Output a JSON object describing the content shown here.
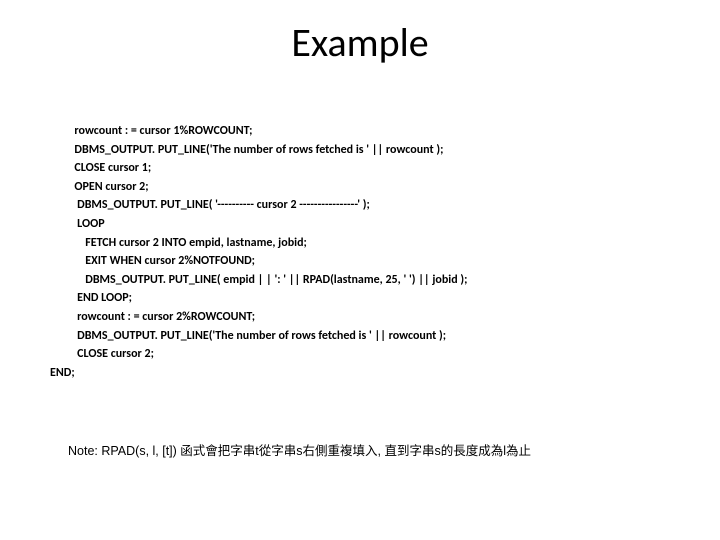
{
  "title": "Example",
  "code": "         rowcount : = cursor 1%ROWCOUNT;\n         DBMS_OUTPUT. PUT_LINE('The number of rows fetched is ' || rowcount );\n         CLOSE cursor 1;\n         OPEN cursor 2;\n          DBMS_OUTPUT. PUT_LINE( '---------- cursor 2 ----------------' );\n          LOOP\n             FETCH cursor 2 INTO empid, lastname, jobid;\n             EXIT WHEN cursor 2%NOTFOUND;\n             DBMS_OUTPUT. PUT_LINE( empid | | ': ' || RPAD(lastname, 25, ' ') || jobid );\n          END LOOP;\n          rowcount : = cursor 2%ROWCOUNT;\n          DBMS_OUTPUT. PUT_LINE('The number of rows fetched is ' || rowcount );\n          CLOSE cursor 2;\nEND;",
  "note": "Note: RPAD(s, l, [t]) 函式會把字串t從字串s右側重複填入, 直到字串s的長度成為l為止"
}
